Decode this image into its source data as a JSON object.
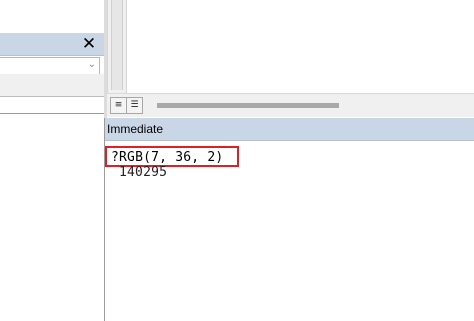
{
  "properties_pane": {
    "close_glyph": "✕",
    "object_combo_value": ""
  },
  "code_window": {
    "procedure_view_icon": "procedure-view-icon",
    "full_module_view_icon": "full-module-view-icon"
  },
  "immediate": {
    "title": "Immediate",
    "lines": [
      "?RGB(7, 36, 2)",
      "140295"
    ]
  },
  "colors": {
    "title_bar": "#c9d6e5",
    "highlight": "#e01e26"
  }
}
